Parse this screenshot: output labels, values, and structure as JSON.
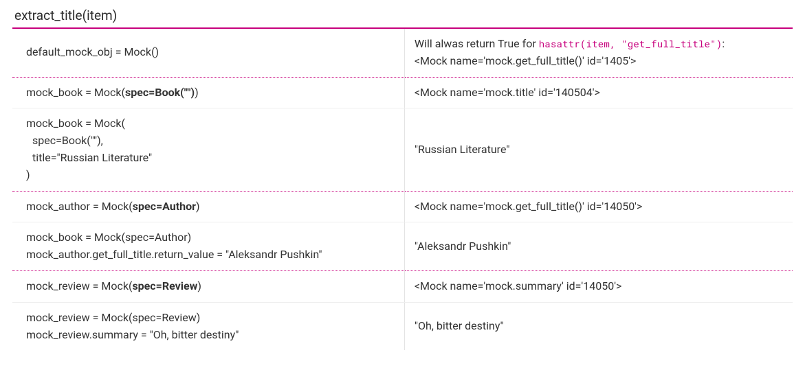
{
  "header": "extract_title(item)",
  "rows": [
    {
      "left_html": "default_mock_obj = Mock()",
      "right_html": "Will alwas return True for <code class=\"inline\">hasattr(item, \"get_full_title\")</code>:<br>&lt;Mock name='mock.get_full_title()' id='1405'&gt;",
      "sep": "dotted"
    },
    {
      "left_html": "mock_book = Mock(<b>spec=Book(&quot;&quot;)</b>)",
      "right_html": "&lt;Mock name='mock.title' id='140504'&gt;",
      "sep": "light"
    },
    {
      "left_html": "mock_book = Mock(<br><span class=\"indent\">spec=Book(&quot;&quot;),</span><span class=\"indent\">title=&quot;Russian Literature&quot;</span>)",
      "right_html": "&quot;Russian Literature&quot;",
      "sep": "dotted"
    },
    {
      "left_html": "mock_author = Mock(<b>spec=Author</b>)",
      "right_html": "&lt;Mock name='mock.get_full_title()' id='14050'&gt;",
      "sep": "light"
    },
    {
      "left_html": "mock_book = Mock(spec=Author)<br>mock_author.get_full_title.return_value = &quot;Aleksandr Pushkin&quot;",
      "right_html": "&quot;Aleksandr Pushkin&quot;",
      "sep": "dotted"
    },
    {
      "left_html": "mock_review = Mock(<b>spec=Review</b>)",
      "right_html": "&lt;Mock name='mock.summary' id='14050'&gt;",
      "sep": "light"
    },
    {
      "left_html": "mock_review = Mock(spec=Review)<br>mock_review.summary = &quot;Oh, bitter destiny&quot;",
      "right_html": "&quot;Oh, bitter destiny&quot;",
      "sep": "none"
    }
  ]
}
